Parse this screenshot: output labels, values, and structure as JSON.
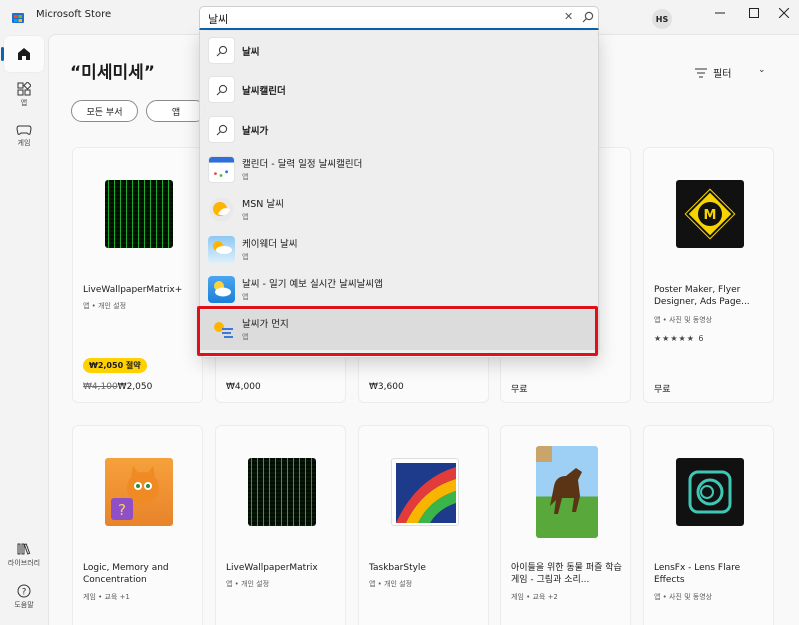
{
  "window": {
    "title": "Microsoft Store",
    "avatar_initials": "HS"
  },
  "nav": {
    "items": [
      {
        "label": "",
        "icon": "home-icon"
      },
      {
        "label": "앱",
        "icon": "apps-icon"
      },
      {
        "label": "게임",
        "icon": "gamepad-icon"
      },
      {
        "label": "라이브러리",
        "icon": "library-icon"
      },
      {
        "label": "도움말",
        "icon": "help-icon"
      }
    ]
  },
  "search": {
    "value": "날씨"
  },
  "suggestions": [
    {
      "text": "날씨",
      "sub": "",
      "icon": "search-icon"
    },
    {
      "text": "날씨캘린더",
      "sub": "",
      "icon": "search-icon"
    },
    {
      "text": "날씨가",
      "sub": "",
      "icon": "search-icon"
    },
    {
      "text": "캘린더 - 달력 일정 날씨캘린더",
      "sub": "앱",
      "icon": "calendar-app-icon"
    },
    {
      "text": "MSN 날씨",
      "sub": "앱",
      "icon": "msn-weather-icon"
    },
    {
      "text": "케이웨더 날씨",
      "sub": "앱",
      "icon": "kweather-icon"
    },
    {
      "text": "날씨 - 일기 예보 실시간 날씨날씨앱",
      "sub": "앱",
      "icon": "weather-app-icon"
    },
    {
      "text": "날씨가 먼지",
      "sub": "앱",
      "icon": "weather-dust-icon"
    }
  ],
  "page": {
    "title": "“미세미세”",
    "chips": [
      "모든 부서",
      "앱"
    ],
    "filter_label": "필터"
  },
  "cards_row1": [
    {
      "name": "LiveWallpaperMatrix+",
      "meta": "앱 • 개인 설정",
      "badge": "₩2,050 절약",
      "old_price": "₩4,100",
      "price": "₩2,050"
    },
    {
      "name": "",
      "meta": "",
      "price": "₩4,000"
    },
    {
      "name": "",
      "meta": "",
      "price": "₩3,600"
    },
    {
      "name": "",
      "meta": "",
      "price": "무료"
    },
    {
      "name": "Poster Maker, Flyer Designer, Ads Page...",
      "meta": "앱 • 사진 및 동영상",
      "rating_count": "6",
      "price": "무료"
    }
  ],
  "cards_row2": [
    {
      "name": "Logic, Memory and Concentration",
      "meta": "게임 • 교육 +1"
    },
    {
      "name": "LiveWallpaperMatrix",
      "meta": "앱 • 개인 설정"
    },
    {
      "name": "TaskbarStyle",
      "meta": "앱 • 개인 설정"
    },
    {
      "name": "아이들을 위한 동물 퍼즐 학습 게임 - 그림과 소리...",
      "meta": "게임 • 교육 +2"
    },
    {
      "name": "LensFx - Lens Flare Effects",
      "meta": "앱 • 사진 및 동영상"
    }
  ],
  "colors": {
    "accent": "#0a64b0",
    "highlight": "#e0101a",
    "badge": "#ffd100"
  }
}
